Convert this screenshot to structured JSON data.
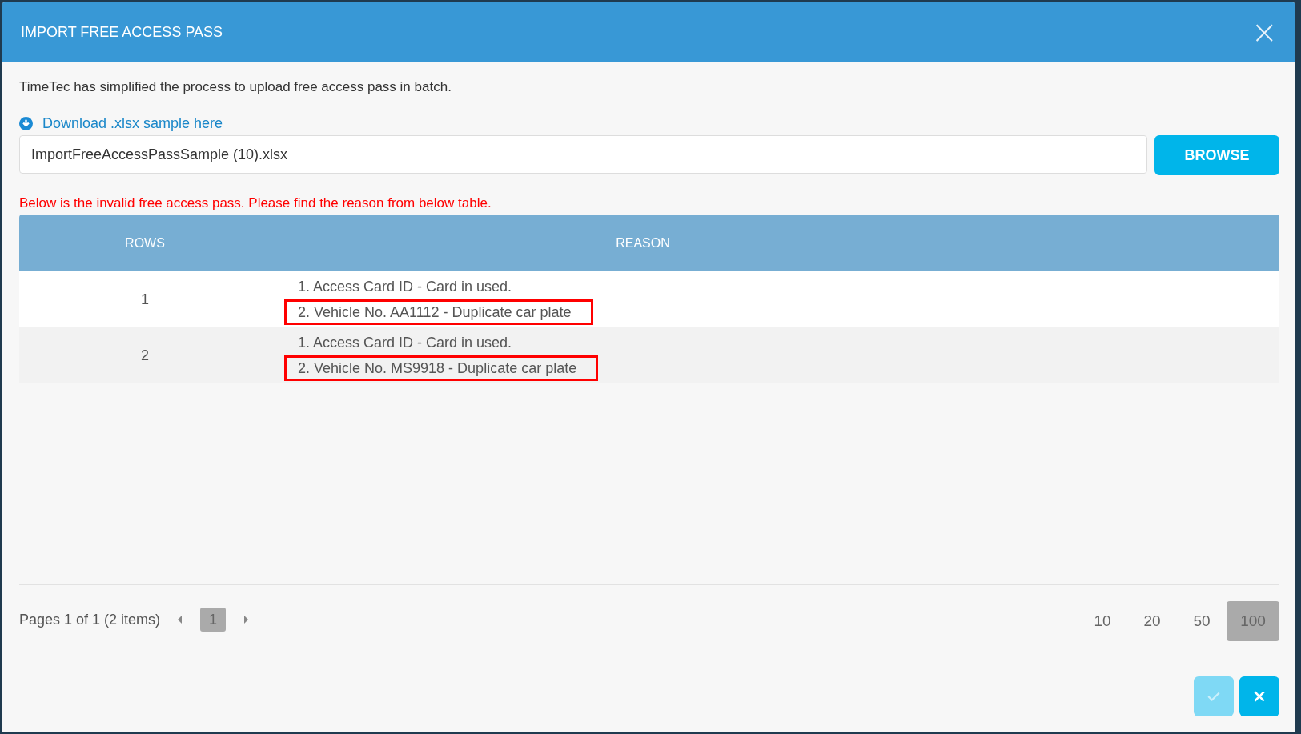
{
  "dialog": {
    "title": "IMPORT FREE ACCESS PASS",
    "close": "×"
  },
  "intro": "TimeTec has simplified the process to upload free access pass in batch.",
  "download_link": "Download .xlsx sample here",
  "file_field": {
    "value": "ImportFreeAccessPassSample (10).xlsx"
  },
  "browse_button": "BROWSE",
  "error_message": "Below is the invalid free access pass. Please find the reason from below table.",
  "table": {
    "columns": [
      "ROWS",
      "REASON"
    ],
    "rows": [
      {
        "row": "1",
        "reasons": [
          {
            "text": "1. Access Card ID - Card in used.",
            "highlighted": false
          },
          {
            "text": "2. Vehicle No. AA1112 - Duplicate car plate",
            "highlighted": true
          }
        ]
      },
      {
        "row": "2",
        "reasons": [
          {
            "text": "1. Access Card ID - Card in used.",
            "highlighted": false
          },
          {
            "text": "2. Vehicle No. MS9918 - Duplicate car plate",
            "highlighted": true
          }
        ]
      }
    ]
  },
  "pager": {
    "summary": "Pages 1 of 1 (2 items)",
    "pages": [
      {
        "label": "1",
        "selected": true
      }
    ],
    "page_sizes": [
      {
        "label": "10",
        "selected": false
      },
      {
        "label": "20",
        "selected": false
      },
      {
        "label": "50",
        "selected": false
      },
      {
        "label": "100",
        "selected": true
      }
    ]
  },
  "actions": [
    {
      "kind": "confirm",
      "disabled": true
    },
    {
      "kind": "cancel",
      "disabled": false
    }
  ]
}
